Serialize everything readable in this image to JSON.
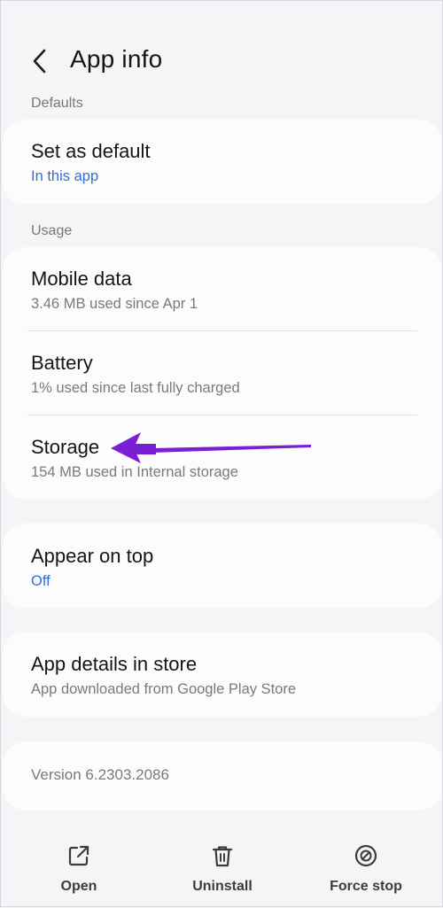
{
  "header": {
    "title": "App info",
    "back_icon": "chevron-left-icon"
  },
  "sections": {
    "defaults_label": "Defaults",
    "usage_label": "Usage"
  },
  "defaults": {
    "set_as_default": {
      "title": "Set as default",
      "subtitle": "In this app"
    }
  },
  "usage": {
    "mobile_data": {
      "title": "Mobile data",
      "subtitle": "3.46 MB used since Apr 1"
    },
    "battery": {
      "title": "Battery",
      "subtitle": "1% used since last fully charged"
    },
    "storage": {
      "title": "Storage",
      "subtitle": "154 MB used in Internal storage"
    }
  },
  "appear_on_top": {
    "title": "Appear on top",
    "subtitle": "Off"
  },
  "app_details": {
    "title": "App details in store",
    "subtitle": "App downloaded from Google Play Store"
  },
  "version": {
    "text": "Version 6.2303.2086"
  },
  "bottom_actions": {
    "open": {
      "label": "Open",
      "icon": "open-external-icon"
    },
    "uninstall": {
      "label": "Uninstall",
      "icon": "trash-icon"
    },
    "force_stop": {
      "label": "Force stop",
      "icon": "block-icon"
    }
  },
  "colors": {
    "background": "#f5f4f6",
    "card": "#fcfcfc",
    "accent_link": "#2f6fd6",
    "annotation_arrow": "#7a1fd6"
  }
}
